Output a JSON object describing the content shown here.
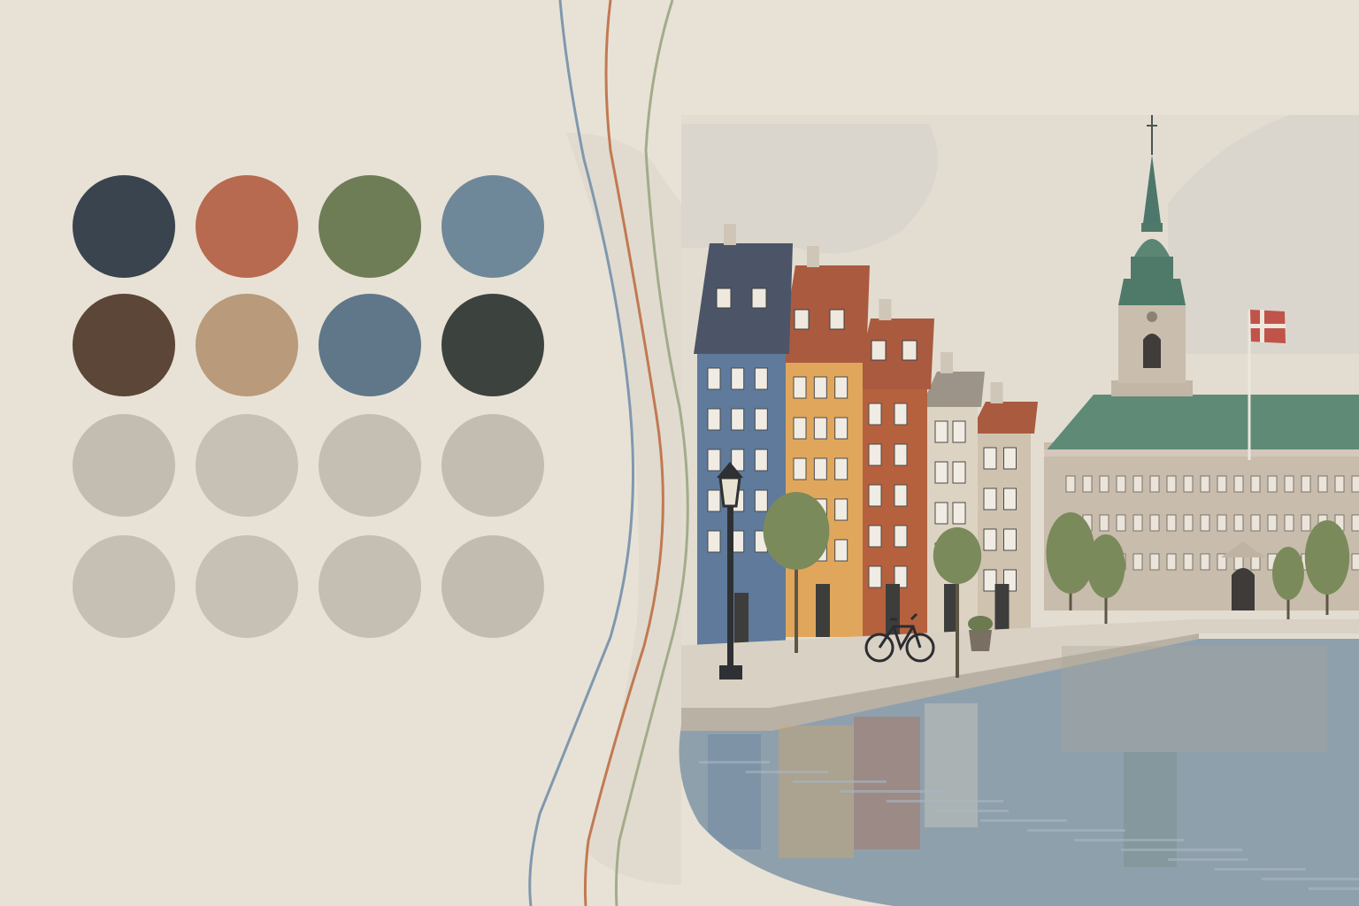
{
  "palette": {
    "rows": [
      [
        "#3a444f",
        "#b76a4f",
        "#6e7d56",
        "#6f8899"
      ],
      [
        "#5c4637",
        "#b99a7a",
        "#5f7789",
        "#3c423e"
      ],
      [
        "#c3bdb1",
        "#c7c1b5",
        "#c5bfb3",
        "#c3bdb1"
      ],
      [
        "#c6c0b4",
        "#c7c1b5",
        "#c5bfb3",
        "#c2bcb0"
      ]
    ]
  },
  "colors": {
    "paper": "#e8e2d6",
    "sky": "#e3ddd1",
    "cloud": "#d6d2ca",
    "water": "#8fa0ad",
    "quay": "#d8d1c4",
    "house_blue": "#5f7a9b",
    "house_yellow": "#e0a75c",
    "house_red": "#b5613e",
    "house_cream": "#ddd3c3",
    "house_beige": "#cfc3b0",
    "roof_slate": "#4b5567",
    "roof_red": "#a95a3f",
    "palace": "#c8bcad",
    "palace_roof": "#5f8a76",
    "spire": "#4f7a69",
    "tree": "#7b8a5b",
    "flag": "#c0544a",
    "line_blue": "#7f98ae",
    "line_orange": "#c17a52",
    "line_green": "#a3ac8a"
  },
  "icons": [
    "street-lamp-icon",
    "bicycle-icon",
    "danish-flag-icon"
  ]
}
